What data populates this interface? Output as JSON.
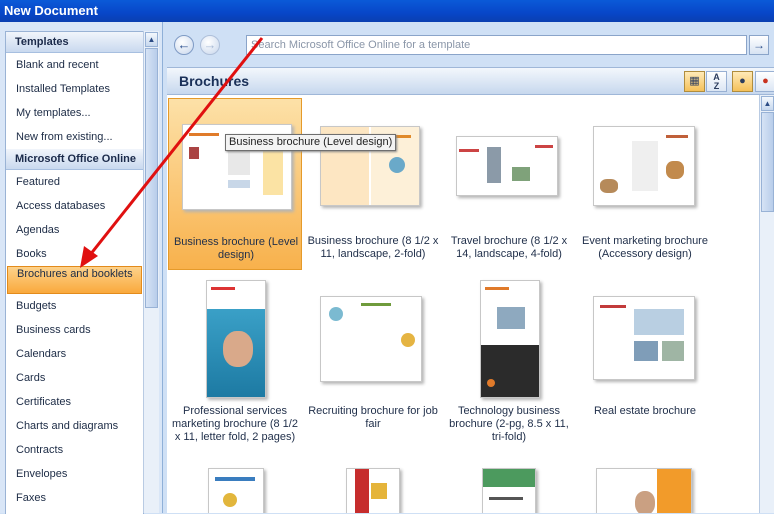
{
  "window": {
    "title": "New Document"
  },
  "left_panel": {
    "templates_header": "Templates",
    "template_items": [
      "Blank and recent",
      "Installed Templates",
      "My templates...",
      "New from existing..."
    ],
    "online_header": "Microsoft Office Online",
    "online_items": [
      "Featured",
      "Access databases",
      "Agendas",
      "Books",
      "Brochures and booklets",
      "Budgets",
      "Business cards",
      "Calendars",
      "Cards",
      "Certificates",
      "Charts and diagrams",
      "Contracts",
      "Envelopes",
      "Faxes"
    ],
    "selected_item": "Brochures and booklets"
  },
  "toolbar": {
    "back_icon": "back-arrow-icon",
    "forward_icon": "forward-arrow-icon",
    "search_placeholder": "Search Microsoft Office Online for a template",
    "go_icon": "go-arrow-icon"
  },
  "gallery": {
    "title": "Brochures",
    "view_icons": [
      "large-icons-view-icon",
      "sort-az-icon"
    ],
    "user_icons": [
      "user-icon",
      "user-remove-icon"
    ],
    "tooltip": "Business brochure (Level design)",
    "tiles": [
      {
        "label": "Business brochure (Level design)",
        "selected": true
      },
      {
        "label": "Business brochure (8 1/2 x 11, landscape, 2-fold)"
      },
      {
        "label": "Travel brochure (8 1/2 x 14, landscape, 4-fold)"
      },
      {
        "label": "Event marketing brochure (Accessory design)"
      },
      {
        "label": "Professional services marketing brochure (8 1/2 x 11, letter fold, 2 pages)"
      },
      {
        "label": "Recruiting brochure for job fair"
      },
      {
        "label": "Technology business brochure (2-pg, 8.5 x 11, tri-fold)"
      },
      {
        "label": "Real estate brochure"
      },
      {
        "label": ""
      },
      {
        "label": ""
      },
      {
        "label": ""
      },
      {
        "label": ""
      }
    ]
  },
  "annotation": {
    "arrow_color": "#e01010"
  }
}
